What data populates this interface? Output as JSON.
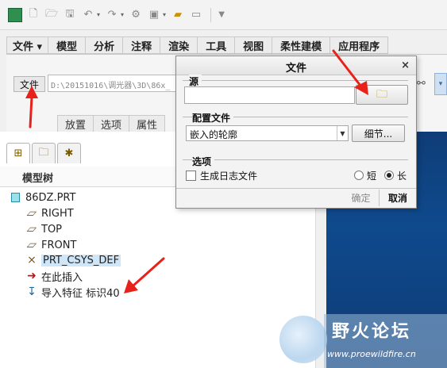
{
  "quick_access": {
    "icons": [
      "app-icon",
      "new-icon",
      "open-icon",
      "save-icon",
      "undo-icon",
      "redo-icon",
      "regenerate-icon",
      "windows-icon",
      "folder-icon",
      "blank-icon",
      "customize-icon"
    ]
  },
  "ribbon_tabs": [
    {
      "label": "文件 ▾"
    },
    {
      "label": "模型"
    },
    {
      "label": "分析"
    },
    {
      "label": "注释"
    },
    {
      "label": "渲染"
    },
    {
      "label": "工具"
    },
    {
      "label": "视图"
    },
    {
      "label": "柔性建模"
    },
    {
      "label": "应用程序"
    }
  ],
  "ribbon": {
    "file_button": "文件",
    "path_value": "D:\\20151016\\调光器\\3D\\86x_"
  },
  "sub_tabs": [
    {
      "label": "放置"
    },
    {
      "label": "选项"
    },
    {
      "label": "属性"
    }
  ],
  "navigator": {
    "title": "模型树",
    "items": [
      {
        "label": "86DZ.PRT",
        "icon": "part-icon"
      },
      {
        "label": "RIGHT",
        "icon": "datum-plane-icon"
      },
      {
        "label": "TOP",
        "icon": "datum-plane-icon"
      },
      {
        "label": "FRONT",
        "icon": "datum-plane-icon"
      },
      {
        "label": "PRT_CSYS_DEF",
        "icon": "csys-icon"
      },
      {
        "label": "在此插入",
        "icon": "insert-here-icon"
      },
      {
        "label": "导入特征 标识40",
        "icon": "import-feature-icon"
      }
    ]
  },
  "dialog": {
    "title": "文件",
    "source_label": "源",
    "source_value": "",
    "profile_label": "配置文件",
    "profile_value": "嵌入的轮廓",
    "details_button": "细节...",
    "options_label": "选项",
    "log_checkbox_label": "生成日志文件",
    "log_checked": false,
    "radio_short": "短",
    "radio_long": "长",
    "radio_selected": "长",
    "ok_button": "确定",
    "cancel_button": "取消"
  },
  "watermark": {
    "text": "野火论坛",
    "url": "www.proewildfire.cn"
  },
  "colors": {
    "graphics_background": "#0f4a8d",
    "annotation_arrow": "#e8221b",
    "selection_highlight": "#cfe6f8"
  }
}
